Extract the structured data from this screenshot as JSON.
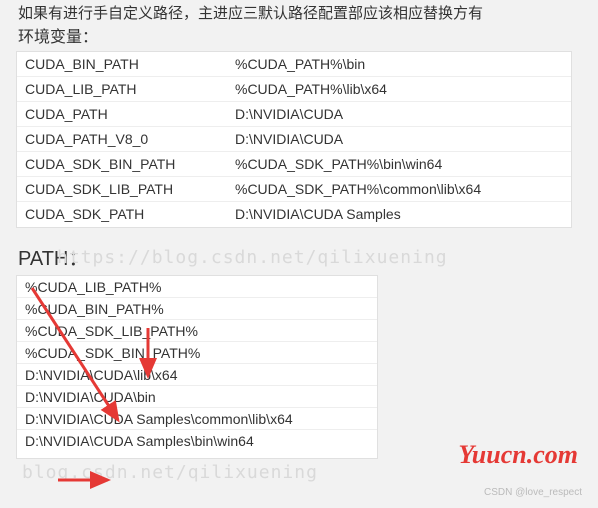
{
  "top_truncated": "如果有进行手自定义路径，主进应三默认路径配置部应该相应替换方有",
  "labels": {
    "env": "环境变量：",
    "path": "PATH："
  },
  "env_vars": [
    {
      "name": "CUDA_BIN_PATH",
      "value": "%CUDA_PATH%\\bin"
    },
    {
      "name": "CUDA_LIB_PATH",
      "value": "%CUDA_PATH%\\lib\\x64"
    },
    {
      "name": "CUDA_PATH",
      "value": "D:\\NVIDIA\\CUDA"
    },
    {
      "name": "CUDA_PATH_V8_0",
      "value": "D:\\NVIDIA\\CUDA"
    },
    {
      "name": "CUDA_SDK_BIN_PATH",
      "value": "%CUDA_SDK_PATH%\\bin\\win64"
    },
    {
      "name": "CUDA_SDK_LIB_PATH",
      "value": "%CUDA_SDK_PATH%\\common\\lib\\x64"
    },
    {
      "name": "CUDA_SDK_PATH",
      "value": "D:\\NVIDIA\\CUDA Samples"
    }
  ],
  "path_entries": [
    "%CUDA_LIB_PATH%",
    "%CUDA_BIN_PATH%",
    "%CUDA_SDK_LIB_PATH%",
    "%CUDA_SDK_BIN_PATH%",
    "D:\\NVIDIA\\CUDA\\lib\\x64",
    "D:\\NVIDIA\\CUDA\\bin",
    "D:\\NVIDIA\\CUDA Samples\\common\\lib\\x64",
    "D:\\NVIDIA\\CUDA Samples\\bin\\win64"
  ],
  "watermarks": {
    "w1": "https://blog.csdn.net/qilixuening",
    "w2": "blog.csdn.net/qilixuening"
  },
  "brand": "Yuucn.com",
  "credit": "CSDN @love_respect"
}
